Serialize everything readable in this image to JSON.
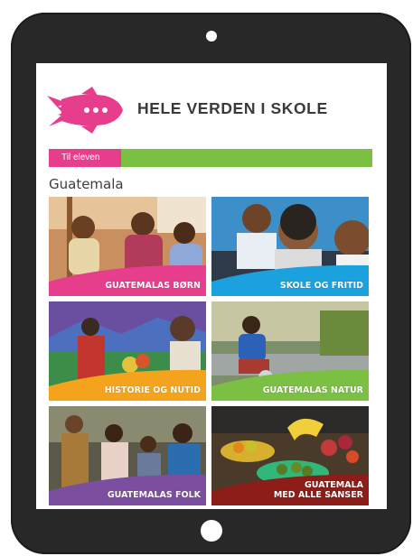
{
  "site": {
    "title": "HELE VERDEN I SKOLE"
  },
  "nav": {
    "tab_label": "Til eleven"
  },
  "page": {
    "country": "Guatemala"
  },
  "tiles": [
    {
      "label": "GUATEMALAS BØRN",
      "color": "#e63e8c"
    },
    {
      "label": "SKOLE OG FRITID",
      "color": "#1ba1dd"
    },
    {
      "label": "HISTORIE OG NUTID",
      "color": "#f3a41c"
    },
    {
      "label": "GUATEMALAS NATUR",
      "color": "#7bbf43"
    },
    {
      "label": "GUATEMALAS FOLK",
      "color": "#7c4ea0"
    },
    {
      "label": "GUATEMALA",
      "label2": "MED ALLE SANSER",
      "color": "#8c1d18"
    }
  ],
  "icons": {
    "logo": "rocket-icon"
  }
}
